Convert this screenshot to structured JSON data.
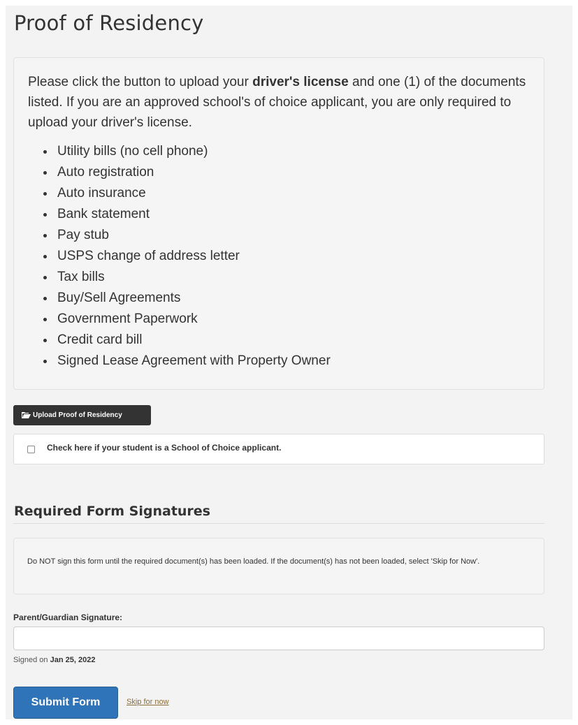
{
  "page": {
    "title": "Proof of Residency"
  },
  "instructions": {
    "prefix": "Please click the button to upload your ",
    "bold": "driver's license",
    "suffix": " and one (1) of the documents listed. If you are an approved school's of choice applicant, you are only required to upload your driver's license."
  },
  "documents": [
    "Utility bills (no cell phone)",
    "Auto registration",
    "Auto insurance",
    "Bank statement",
    "Pay stub",
    "USPS change of address letter",
    "Tax bills",
    "Buy/Sell Agreements",
    "Government Paperwork",
    "Credit card bill",
    "Signed Lease Agreement with Property Owner"
  ],
  "upload": {
    "label": "Upload Proof of Residency",
    "icon": "folder-open-icon"
  },
  "school_choice": {
    "label": "Check here if your student is a School of Choice applicant.",
    "checked": false
  },
  "signatures": {
    "title": "Required Form Signatures",
    "warning": "Do NOT sign this form until the required document(s) has been loaded. If the document(s) has not been loaded, select 'Skip for Now'.",
    "field_label": "Parent/Guardian Signature:",
    "field_value": "",
    "signed_prefix": "Signed on ",
    "signed_date": "Jan 25, 2022"
  },
  "actions": {
    "submit_label": "Submit Form",
    "skip_label": "Skip for now"
  },
  "colors": {
    "primary": "#2f74b8",
    "dark_button": "#333333",
    "link": "#8a6d3b",
    "panel_bg": "#f5f5f5"
  }
}
